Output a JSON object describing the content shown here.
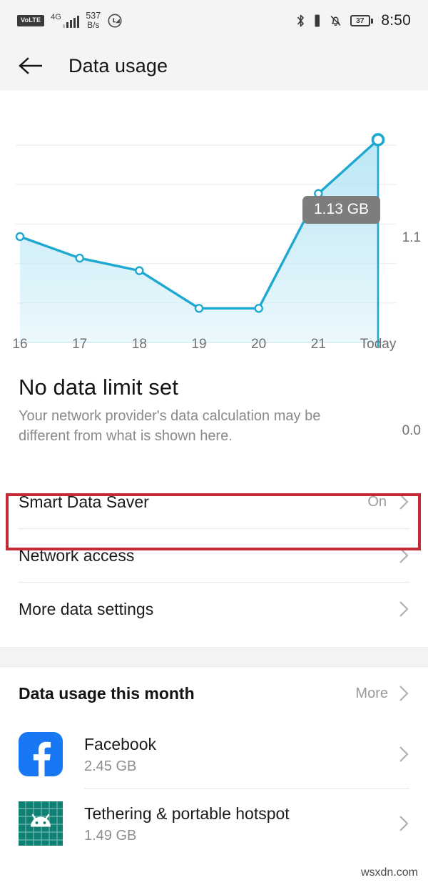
{
  "status_bar": {
    "volte_label": "VoLTE",
    "network_gen": "4G",
    "signal_icon": "signal-bars-icon",
    "data_speed_value": "537",
    "data_speed_unit": "B/s",
    "data_saver_icon": "data-saver-icon",
    "bluetooth_icon": "bluetooth-icon",
    "vibrate_icon": "vibrate-icon",
    "mute_icon": "bell-muted-icon",
    "battery_percent": "37",
    "clock": "8:50"
  },
  "app_bar": {
    "back_icon": "back-arrow-icon",
    "title": "Data usage"
  },
  "chart_data": {
    "type": "area",
    "title": "",
    "categories": [
      "16",
      "17",
      "18",
      "19",
      "20",
      "21",
      "Today"
    ],
    "values": [
      0.59,
      0.47,
      0.4,
      0.19,
      0.19,
      0.83,
      1.13
    ],
    "tooltip_label": "1.13 GB",
    "tooltip_point_index": 6,
    "ylim": [
      0.0,
      1.1
    ],
    "y_tick_labels": [
      "1.1",
      "0.0"
    ],
    "xlabel": "",
    "ylabel": "",
    "grid": true,
    "line_color": "#1ca8d0",
    "fill_color": "#b8e6f5",
    "marker_fill": "#ffffff"
  },
  "headline": {
    "title": "No data limit set",
    "subtitle": "Your network provider's data calculation may be different from what is shown here."
  },
  "settings_rows": [
    {
      "label": "Smart Data Saver",
      "value": "On",
      "chevron_icon": "chevron-right-icon",
      "highlighted": true
    },
    {
      "label": "Network access",
      "value": "",
      "chevron_icon": "chevron-right-icon",
      "highlighted": false
    },
    {
      "label": "More data settings",
      "value": "",
      "chevron_icon": "chevron-right-icon",
      "highlighted": false
    }
  ],
  "usage_section": {
    "title": "Data usage this month",
    "more_label": "More",
    "more_chevron_icon": "chevron-right-icon",
    "apps": [
      {
        "name": "Facebook",
        "size": "2.45 GB",
        "icon": "facebook-icon",
        "chevron_icon": "chevron-right-icon"
      },
      {
        "name": "Tethering & portable hotspot",
        "size": "1.49 GB",
        "icon": "android-hotspot-icon",
        "chevron_icon": "chevron-right-icon"
      }
    ]
  },
  "watermark": {
    "text": "wsxdn.com"
  },
  "colors": {
    "highlight_border": "#c22b33",
    "chart_accent": "#1ca8d0",
    "facebook_blue": "#1877f2",
    "android_teal": "#0f8073",
    "tooltip_bg": "#7d7d7d"
  }
}
